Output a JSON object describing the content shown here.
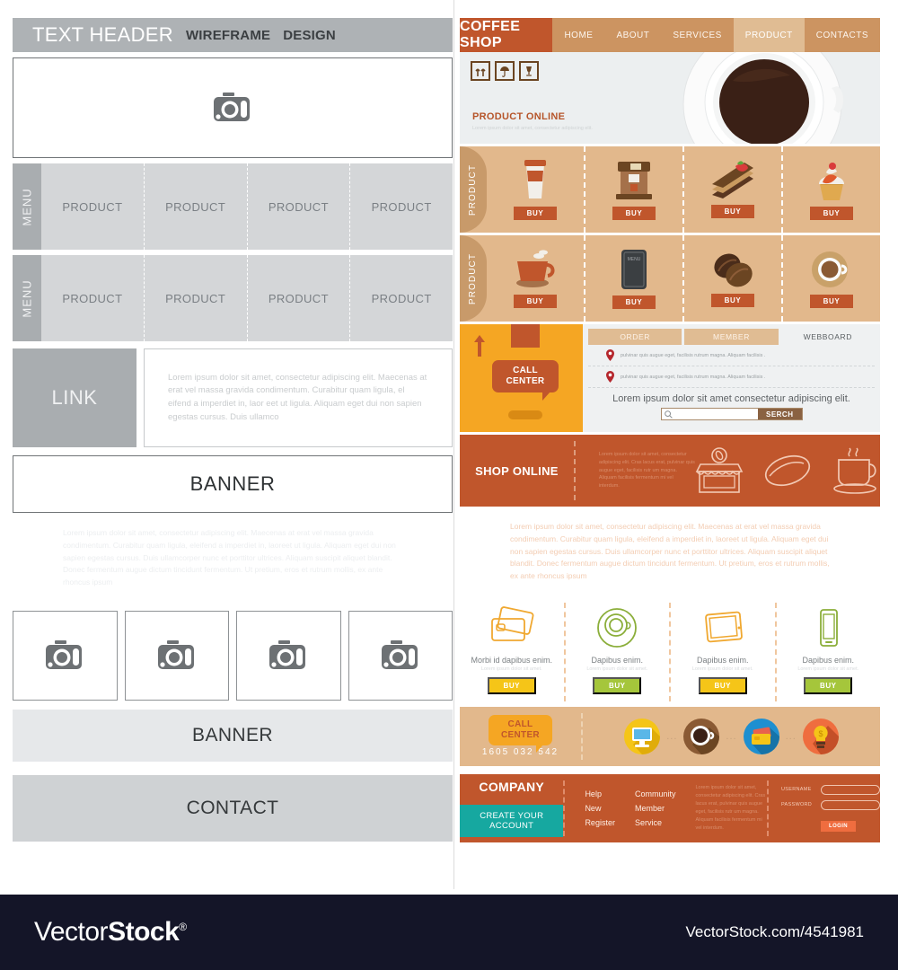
{
  "left_wireframe": {
    "header": {
      "title": "TEXT HEADER",
      "sub1": "WIREFRAME",
      "sub2": "DESIGN"
    },
    "hero_icon": "camera-icon",
    "menu_rows": [
      {
        "tab": "MENU",
        "cells": [
          "PRODUCT",
          "PRODUCT",
          "PRODUCT",
          "PRODUCT"
        ]
      },
      {
        "tab": "MENU",
        "cells": [
          "PRODUCT",
          "PRODUCT",
          "PRODUCT",
          "PRODUCT"
        ]
      }
    ],
    "link_block": {
      "label": "LINK",
      "text": "Lorem ipsum dolor sit amet, consectetur adipiscing elit. Maecenas at erat vel massa gravida  condimentum. Curabitur quam ligula, el eifend a imperdiet in, laor eet ut ligula. Aliquam eget dui non  sapien egestas cursus. Duis ullamco"
    },
    "banner_top": "BANNER",
    "paragraph": "Lorem ipsum dolor sit amet, consectetur adipiscing elit. Maecenas at erat vel massa gravida condimentum. Curabitur quam ligula, eleifend a imperdiet in, laoreet ut ligula. Aliquam eget dui non sapien egestas cursus. Duis ullamcorper nunc et porttitor ultrices. Aliquam suscipit aliquet blandit. Donec fermentum augue dictum tincidunt fermentum. Ut pretium, eros et rutrum mollis, ex ante rhoncus ipsum",
    "thumbnails": [
      "camera-icon",
      "camera-icon",
      "camera-icon",
      "camera-icon"
    ],
    "banner_bottom": "BANNER",
    "contact": "CONTACT"
  },
  "right_site": {
    "brand": "COFFEE SHOP",
    "nav": [
      {
        "label": "HOME",
        "active": false
      },
      {
        "label": "ABOUT",
        "active": false
      },
      {
        "label": "SERVICES",
        "active": false
      },
      {
        "label": "PRODUCT",
        "active": true
      },
      {
        "label": "CONTACTS",
        "active": false
      }
    ],
    "hero": {
      "title": "PRODUCT ONLINE",
      "subtitle": "Lorem ipsum dolor sit amet, consectetur adipiscing elit.",
      "shipping_icons": [
        "this-side-up-icon",
        "keep-dry-umbrella-icon",
        "fragile-glass-icon"
      ],
      "image": "coffee-cup-top-view"
    },
    "product_rows": [
      {
        "tab": "PRODUCT",
        "items": [
          {
            "icon": "takeaway-cup-icon",
            "buy": "BUY"
          },
          {
            "icon": "espresso-machine-icon",
            "buy": "BUY"
          },
          {
            "icon": "cake-slice-icon",
            "buy": "BUY"
          },
          {
            "icon": "cupcake-icon",
            "buy": "BUY"
          }
        ]
      },
      {
        "tab": "PRODUCT",
        "items": [
          {
            "icon": "coffee-mug-icon",
            "buy": "BUY"
          },
          {
            "icon": "menu-board-icon",
            "buy": "BUY",
            "label": "MENU"
          },
          {
            "icon": "coffee-beans-icon",
            "buy": "BUY"
          },
          {
            "icon": "coffee-cup-saucer-icon",
            "buy": "BUY"
          }
        ]
      }
    ],
    "call_center_box": {
      "line1": "CALL",
      "line2": "CENTER"
    },
    "order_panel": {
      "tabs": [
        {
          "label": "ORDER",
          "style": "filled"
        },
        {
          "label": "MEMBER",
          "style": "filled"
        },
        {
          "label": "WEBBOARD",
          "style": "plain"
        }
      ],
      "list": [
        "pulvinar quis augue eget, facilisis rutrum magna. Aliquam facilisis .",
        "pulvinar quis augue eget, facilisis rutrum magna. Aliquam facilisis ."
      ],
      "lead": "Lorem ipsum dolor sit amet consectetur adipiscing elit.",
      "search_placeholder": "",
      "search_button": "SERCH"
    },
    "shop_online": {
      "title": "SHOP ONLINE",
      "text": "Lorem ipsum dolor sit amet, consectetur adipiscing elit. Cras lacus erat, pulvinar quis augue eget, facilisis rutr um magna. Aliquam facilisis fermentum mi vel interdum.",
      "icons": [
        "shop-front-icon",
        "coffee-bean-icon",
        "coffee-cup-outline-icon"
      ]
    },
    "paragraph": "Lorem ipsum dolor sit amet, consectetur adipiscing elit. Maecenas at erat vel massa gravida condimentum. Curabitur quam ligula, eleifend a imperdiet in, laoreet ut ligula. Aliquam eget dui non sapien egestas cursus. Duis ullamcorper nunc et porttitor ultrices. Aliquam suscipit aliquet blandit. Donec fermentum augue dictum tincidunt fermentum. Ut pretium, eros et rutrum mollis, ex ante rhoncus ipsum",
    "features": [
      {
        "icon": "credit-cards-icon",
        "title": "Morbi id dapibus enim.",
        "sub": "Lorem ipsum dolor sit amet.",
        "buy": "BUY",
        "buy_color": "yellow"
      },
      {
        "icon": "coffee-cup-outline-icon",
        "title": "Dapibus enim.",
        "sub": "Lorem ipsum dolor sit amet.",
        "buy": "BUY",
        "buy_color": "green"
      },
      {
        "icon": "tablet-icon",
        "title": "Dapibus enim.",
        "sub": "Lorem ipsum dolor sit amet.",
        "buy": "BUY",
        "buy_color": "yellow"
      },
      {
        "icon": "smartphone-icon",
        "title": "Dapibus enim.",
        "sub": "Lorem ipsum dolor sit amet.",
        "buy": "BUY",
        "buy_color": "green"
      }
    ],
    "call_bar": {
      "line1": "CALL",
      "line2": "CENTER",
      "phone": "1605 032 542",
      "icons": [
        "monitor-icon",
        "coffee-cup-circle-icon",
        "wallet-cards-icon",
        "lightbulb-idea-icon"
      ],
      "separator": "..."
    },
    "footer": {
      "company": "COMPANY",
      "create_account": "CREATE YOUR ACCOUNT",
      "links_col1": [
        "Help",
        "New",
        "Register"
      ],
      "links_col2": [
        "Community",
        "Member",
        "Service"
      ],
      "text": "Lorem ipsum dolor sit amet, consectetur adipiscing elit. Cras lacus erat, pulvinar quis augue eget, facilisis rutr um magna. Aliquam facilisis fermentum mi vel interdum.",
      "username_label": "USERNAME",
      "password_label": "PASSWORD",
      "username_value": "",
      "password_value": "",
      "login_button": "LOGIN"
    }
  },
  "watermark": {
    "logo_light": "Vector",
    "logo_bold": "Stock",
    "registered": "®",
    "url": "VectorStock.com/4541981"
  },
  "colors": {
    "brand_orange": "#c0562c",
    "nav_tan": "#cc9461",
    "nav_active": "#e0bc93",
    "product_bg": "#e2b88c",
    "product_tab": "#c89a6a",
    "call_yellow": "#f5a623",
    "teal": "#16a8a0",
    "buy_yellow": "#f5c518",
    "buy_green": "#a5c63b",
    "wireframe_gray": "#aeb2b5",
    "watermark_bg": "#141528"
  }
}
